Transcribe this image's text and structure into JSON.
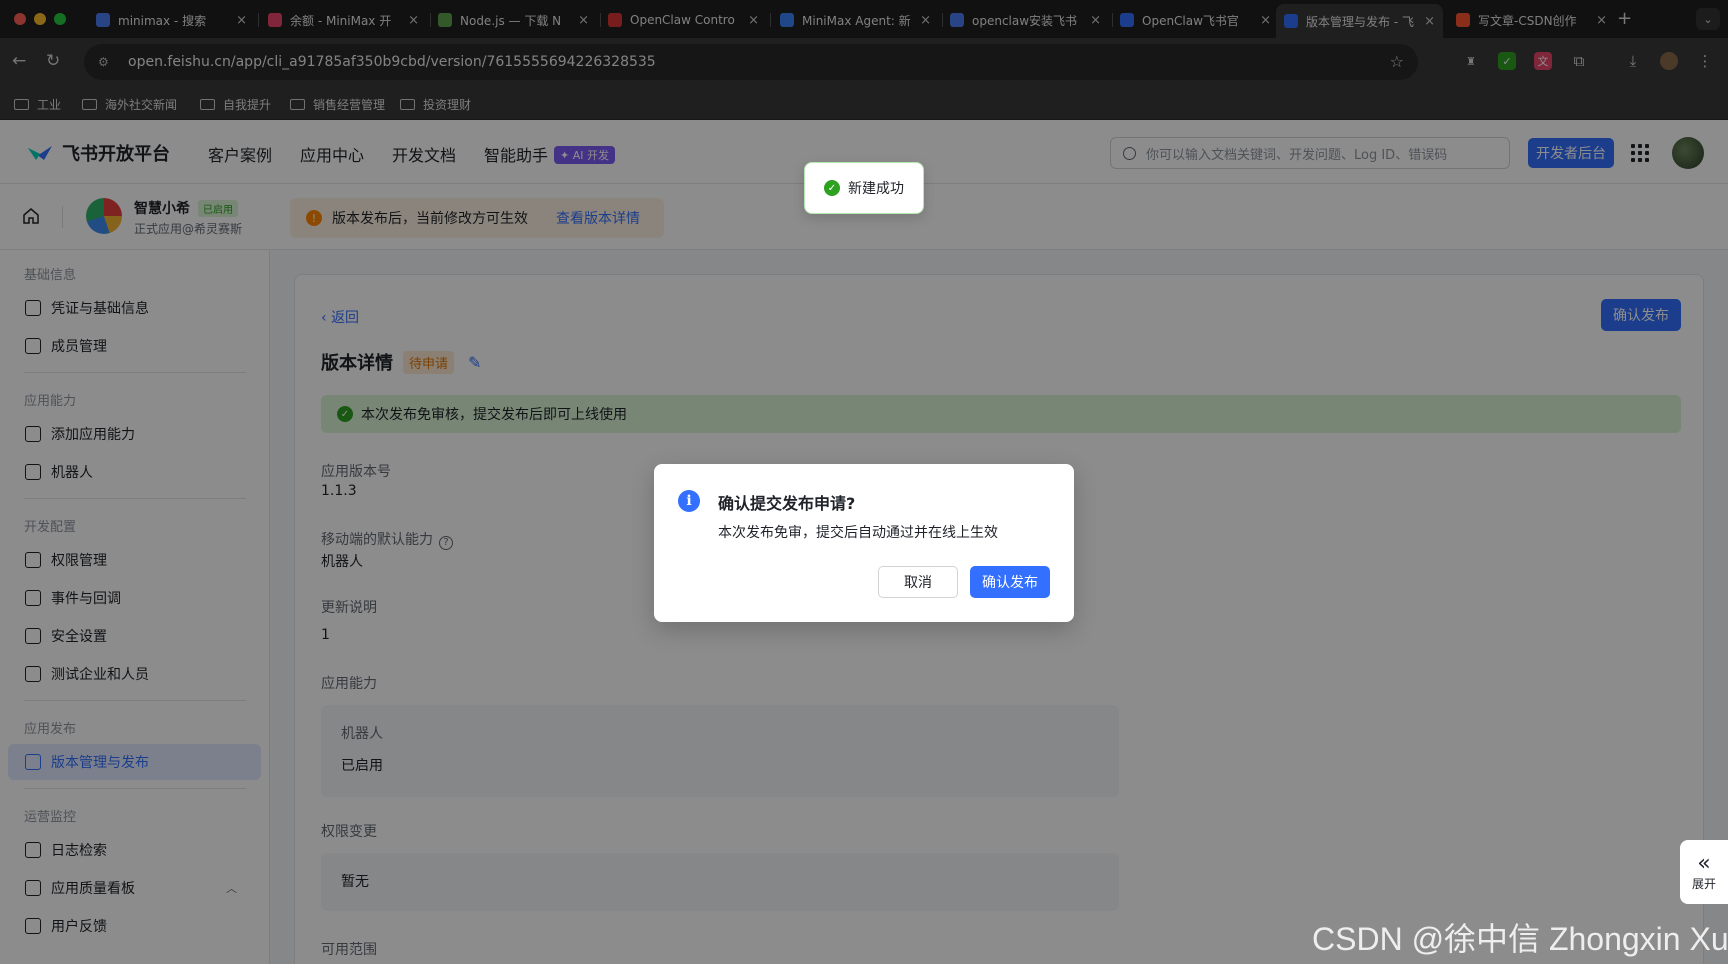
{
  "browser": {
    "tabs": [
      {
        "title": "minimax - 搜索",
        "fav": "search-icon",
        "color": "#4a7cf0"
      },
      {
        "title": "余额 - MiniMax 开",
        "fav": "minimax-icon",
        "color": "#e8456b"
      },
      {
        "title": "Node.js — 下载 N",
        "fav": "nodejs-icon",
        "color": "#5fa04e"
      },
      {
        "title": "OpenClaw Contro",
        "fav": "openclaw-icon",
        "color": "#d93636"
      },
      {
        "title": "MiniMax Agent: 新",
        "fav": "minimax-agent-icon",
        "color": "#3b82f6"
      },
      {
        "title": "openclaw安装飞书",
        "fav": "search-icon",
        "color": "#4a7cf0"
      },
      {
        "title": "OpenClaw飞书官",
        "fav": "feishu-icon",
        "color": "#3370ff"
      },
      {
        "title": "版本管理与发布 - 飞",
        "fav": "feishu-icon",
        "color": "#3370ff"
      },
      {
        "title": "写文章-CSDN创作",
        "fav": "csdn-icon",
        "color": "#fc5531"
      }
    ],
    "url": "open.feishu.cn/app/cli_a91785af350b9cbd/version/7615555694226328535",
    "bookmarks": [
      "工业",
      "海外社交新闻",
      "自我提升",
      "销售经营管理",
      "投资理财"
    ]
  },
  "topnav": {
    "logo": "飞书开放平台",
    "menu": [
      "客户案例",
      "应用中心",
      "开发文档",
      "智能助手"
    ],
    "ai_tag": "✦ AI 开发",
    "search_placeholder": "你可以输入文档关键词、开发问题、Log ID、错误码",
    "dev_button": "开发者后台"
  },
  "appbar": {
    "app_name": "智慧小希",
    "status": "已启用",
    "subtitle": "正式应用@希灵赛斯",
    "notice": "版本发布后，当前修改方可生效",
    "notice_link": "查看版本详情"
  },
  "sidebar": {
    "groups": [
      {
        "title": "基础信息",
        "items": [
          "凭证与基础信息",
          "成员管理"
        ]
      },
      {
        "title": "应用能力",
        "items": [
          "添加应用能力",
          "机器人"
        ]
      },
      {
        "title": "开发配置",
        "items": [
          "权限管理",
          "事件与回调",
          "安全设置",
          "测试企业和人员"
        ]
      },
      {
        "title": "应用发布",
        "items": [
          "版本管理与发布"
        ]
      },
      {
        "title": "运营监控",
        "items": [
          "日志检索",
          "应用质量看板",
          "用户反馈"
        ]
      }
    ]
  },
  "content": {
    "back": "返回",
    "confirm_top": "确认发布",
    "title": "版本详情",
    "status": "待申请",
    "banner": "本次发布免审核，提交发布后即可上线使用",
    "fields": {
      "version_label": "应用版本号",
      "version_value": "1.1.3",
      "mobile_label": "移动端的默认能力",
      "mobile_value": "机器人",
      "notes_label": "更新说明",
      "notes_value": "1",
      "abilities_label": "应用能力",
      "abilities_name": "机器人",
      "abilities_state": "已启用",
      "perm_label": "权限变更",
      "perm_value": "暂无",
      "scope_label": "可用范围"
    }
  },
  "toast": "新建成功",
  "dialog": {
    "title": "确认提交发布申请?",
    "body": "本次发布免审，提交后自动通过并在线上生效",
    "cancel": "取消",
    "ok": "确认发布"
  },
  "expand": "展开",
  "watermark": "CSDN @徐中信 Zhongxin Xu"
}
